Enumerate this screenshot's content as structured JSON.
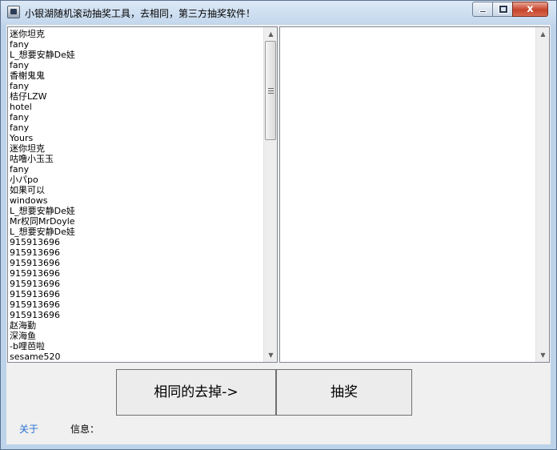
{
  "window": {
    "title": "小银湖随机滚动抽奖工具，去相同，第三方抽奖软件！",
    "close_glyph": "x"
  },
  "left_list": {
    "items": [
      "迷你坦克",
      "fany",
      "L_想要安静De娃",
      "fany",
      "香榭鬼鬼",
      "fany",
      "桔仔LZW",
      "hotel",
      "fany",
      "fany",
      "Yours",
      "迷你坦克",
      "咕噜小玉玉",
      "fany",
      "小パpo",
      "如果可以",
      "windows",
      "L_想要安静De娃",
      "Mr权同MrDoyle",
      "L_想要安静De娃",
      "915913696",
      "915913696",
      "915913696",
      "915913696",
      "915913696",
      "915913696",
      "915913696",
      "915913696",
      "赵海勤",
      "深海鱼",
      "-b哩芭啦",
      "sesame520"
    ]
  },
  "scrollbar": {
    "up_glyph": "▲",
    "down_glyph": "▼"
  },
  "buttons": {
    "dedupe_label": "相同的去掉->",
    "draw_label": "抽奖"
  },
  "footer": {
    "about_label": "关于",
    "info_label": "信息："
  },
  "colors": {
    "link": "#2870d0",
    "window_frame": "#bcd3ea",
    "client_bg": "#f0f0f0"
  }
}
